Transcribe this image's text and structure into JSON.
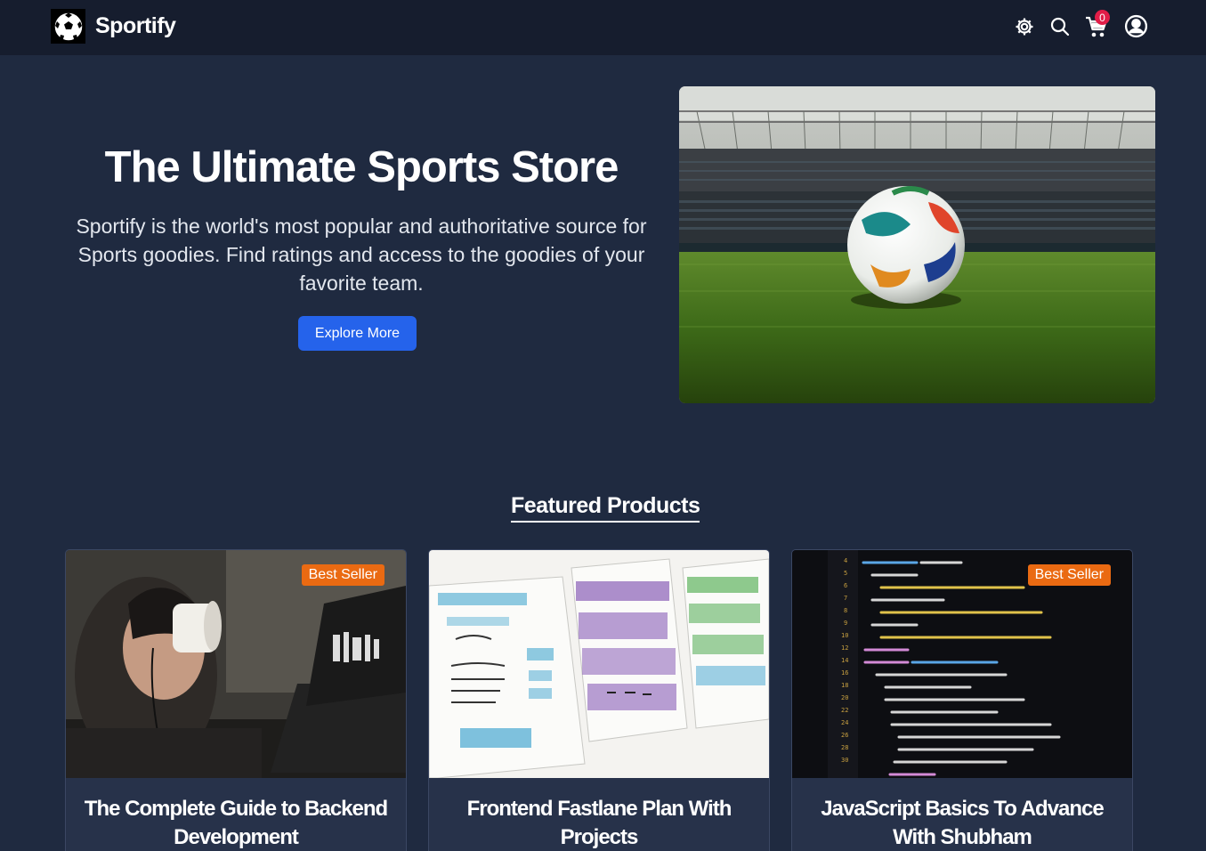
{
  "navbar": {
    "brand": "Sportify",
    "cart_count": "0",
    "icons": [
      "settings-icon",
      "search-icon",
      "cart-icon",
      "user-icon"
    ]
  },
  "hero": {
    "title": "The Ultimate Sports Store",
    "description": "Sportify is the world's most popular and authoritative source for Sports goodies. Find ratings and access to the goodies of your favorite team.",
    "button_label": "Explore More"
  },
  "featured": {
    "heading": "Featured Products",
    "products": [
      {
        "title": "The Complete Guide to Backend Development",
        "badge": "Best Seller"
      },
      {
        "title": "Frontend Fastlane Plan With Projects",
        "badge": ""
      },
      {
        "title": "JavaScript Basics To Advance With Shubham",
        "badge": "Best Seller"
      }
    ]
  },
  "colors": {
    "navbar_bg": "#161d2e",
    "page_bg": "#1f2a40",
    "primary_button": "#2563eb",
    "badge": "#ea6a12",
    "cart_badge": "#e11d48"
  }
}
